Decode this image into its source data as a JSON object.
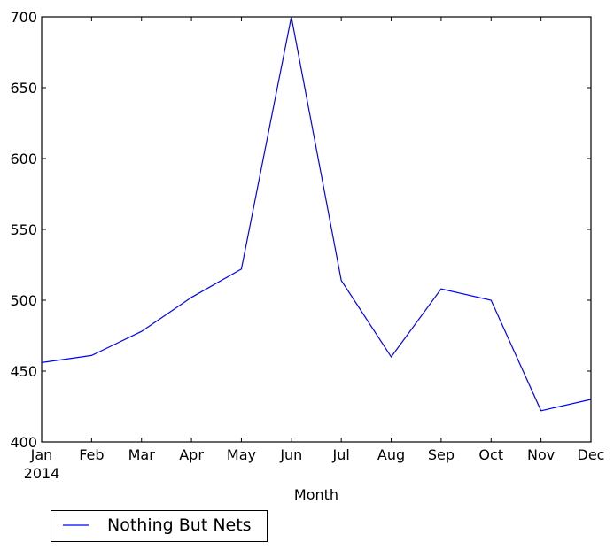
{
  "chart_data": {
    "type": "line",
    "title": "",
    "xlabel": "Month",
    "ylabel": "",
    "categories": [
      "Jan",
      "Feb",
      "Mar",
      "Apr",
      "May",
      "Jun",
      "Jul",
      "Aug",
      "Sep",
      "Oct",
      "Nov",
      "Dec"
    ],
    "x_year_label": "2014",
    "ylim": [
      400,
      700
    ],
    "yticks": [
      400,
      450,
      500,
      550,
      600,
      650,
      700
    ],
    "grid": false,
    "legend_position": "below-left",
    "series": [
      {
        "name": "Nothing But Nets",
        "color": "#0000ff",
        "values": [
          456,
          461,
          478,
          502,
          522,
          700,
          514,
          460,
          508,
          500,
          422,
          430
        ]
      }
    ]
  }
}
